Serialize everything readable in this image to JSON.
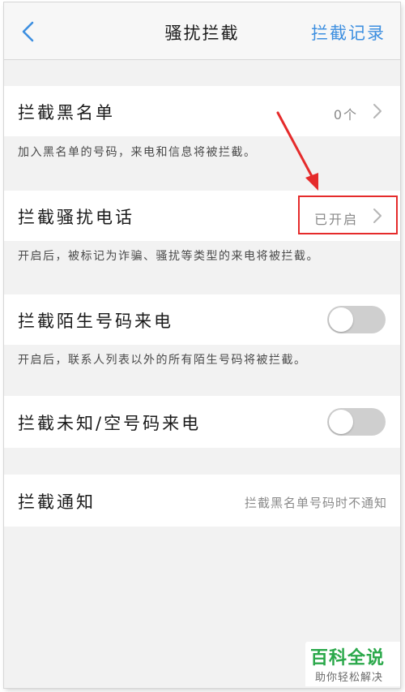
{
  "nav": {
    "back_icon": "chevron-left-icon",
    "title": "骚扰拦截",
    "right_action": "拦截记录"
  },
  "rows": {
    "blacklist": {
      "label": "拦截黑名单",
      "value": "0个",
      "description": "加入黑名单的号码，来电和信息将被拦截。"
    },
    "harassment": {
      "label": "拦截骚扰电话",
      "value": "已开启",
      "description": "开启后，被标记为诈骗、骚扰等类型的来电将被拦截。"
    },
    "stranger": {
      "label": "拦截陌生号码来电",
      "toggle_on": false,
      "description": "开启后，联系人列表以外的所有陌生号码将被拦截。"
    },
    "unknown": {
      "label": "拦截未知/空号码来电",
      "toggle_on": false
    },
    "notify": {
      "label": "拦截通知",
      "value": "拦截黑名单号码时不通知"
    }
  },
  "colors": {
    "accent_blue": "#3d8fe0",
    "annotation_red": "#e52b2b",
    "toggle_off": "#cfcfcf",
    "watermark_green": "#2aa84a"
  },
  "watermark": {
    "title": "百科全说",
    "subtitle": "助你轻松解决"
  }
}
